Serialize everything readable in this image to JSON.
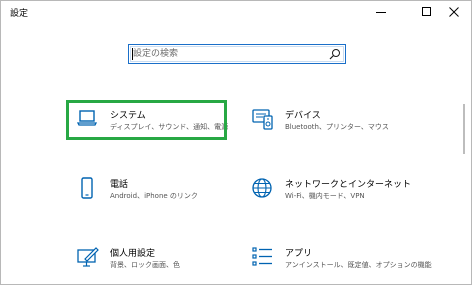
{
  "window": {
    "title": "設定"
  },
  "controls": {
    "minimize_icon": "minimize-icon",
    "maximize_icon": "maximize-icon",
    "close_icon": "close-icon"
  },
  "search": {
    "placeholder": "設定の検索",
    "value": ""
  },
  "tiles": [
    {
      "name": "システム",
      "desc": "ディスプレイ、サウンド、通知、電源",
      "icon": "laptop-icon",
      "highlighted": true
    },
    {
      "name": "デバイス",
      "desc": "Bluetooth、プリンター、マウス",
      "icon": "devices-icon",
      "highlighted": false
    },
    {
      "name": "電話",
      "desc": "Android、iPhone のリンク",
      "icon": "phone-icon",
      "highlighted": false
    },
    {
      "name": "ネットワークとインターネット",
      "desc": "Wi-Fi、機内モード、VPN",
      "icon": "globe-icon",
      "highlighted": false
    },
    {
      "name": "個人用設定",
      "desc": "背景、ロック画面、色",
      "icon": "personalization-icon",
      "highlighted": false
    },
    {
      "name": "アプリ",
      "desc": "アンインストール、既定値、オプションの機能",
      "icon": "apps-icon",
      "highlighted": false
    }
  ],
  "colors": {
    "accent": "#0063b1",
    "highlight": "#27a844",
    "search_border": "#1a6fc9"
  }
}
